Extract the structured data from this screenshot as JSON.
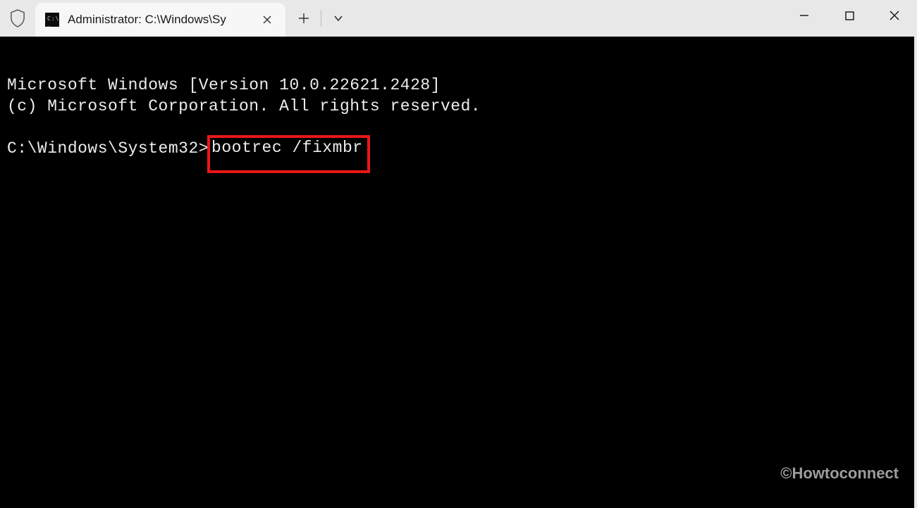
{
  "titlebar": {
    "tab": {
      "title": "Administrator: C:\\Windows\\Sy"
    }
  },
  "terminal": {
    "line1": "Microsoft Windows [Version 10.0.22621.2428]",
    "line2": "(c) Microsoft Corporation. All rights reserved.",
    "prompt": "C:\\Windows\\System32>",
    "command": "bootrec /fixmbr"
  },
  "watermark": "©Howtoconnect",
  "icons": {
    "shield": "shield-icon",
    "terminal": "terminal-icon",
    "close": "x-icon",
    "plus": "plus-icon",
    "chevron": "chevron-down-icon",
    "minimize": "minimize-icon",
    "maximize": "maximize-icon",
    "windowClose": "window-close-icon"
  },
  "colors": {
    "titlebarBg": "#e8e8e8",
    "tabBg": "#f7f7f7",
    "terminalBg": "#000000",
    "terminalFg": "#ececec",
    "highlight": "#e91717"
  }
}
